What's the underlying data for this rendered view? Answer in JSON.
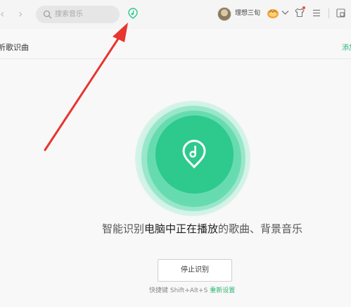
{
  "topbar": {
    "back_icon": "chevron-left-icon",
    "forward_icon": "chevron-right-icon",
    "search": {
      "placeholder": "搜索音乐",
      "icon": "search-icon"
    },
    "recognize_icon": "music-recognize-icon",
    "user": {
      "name": "理想三旬",
      "avatar": "avatar"
    },
    "vip_icon": "vip-badge-icon",
    "dropdown_icon": "chevron-down-icon",
    "skin_icon": "shirt-icon",
    "menu_icon": "menu-icon",
    "mini_icon": "mini-mode-icon"
  },
  "subheader": {
    "title": "听歌识曲",
    "link": "添加"
  },
  "main": {
    "hint_prefix": "智能识别",
    "hint_strong": "电脑中正在播放",
    "hint_suffix": "的歌曲、背景音乐",
    "stop_button": "停止识别",
    "shortcut_prefix": "快捷键 Shift+Alt+S",
    "shortcut_reset": "重新设置"
  },
  "colors": {
    "accent": "#2dc98d",
    "link": "#2bb673",
    "arrow": "#e8352e"
  }
}
